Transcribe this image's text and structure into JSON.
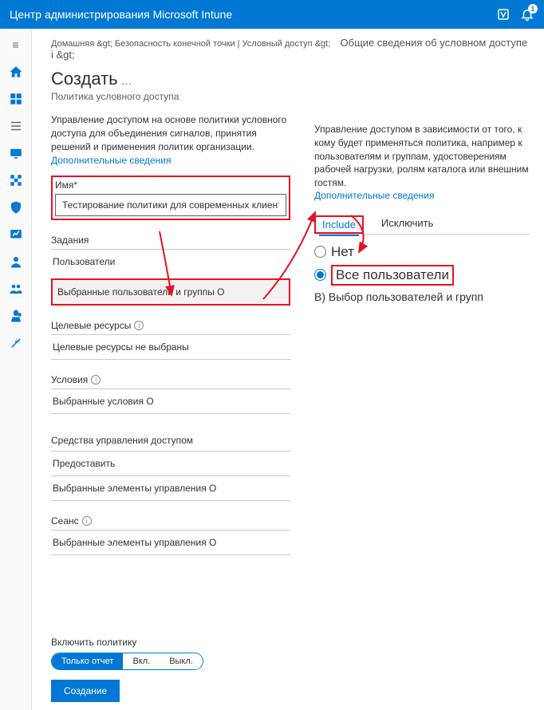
{
  "header": {
    "title": "Центр администрирования Microsoft Intune",
    "badge": "1"
  },
  "breadcrumb": {
    "home": "Домашняя &gt;",
    "path1": "Безопасность конечной точки | Условный доступ &gt;",
    "path2": "Общие сведения об условном доступе i &gt;"
  },
  "page": {
    "title": "Создать",
    "ellipsis": "…",
    "sub": "Политика условного доступа"
  },
  "left": {
    "desc": "Управление доступом на основе политики условного доступа для объединения сигналов, принятия решений и применения политик организации.",
    "more": "Дополнительные сведения",
    "name_label": "Имя",
    "name_value": "Тестирование политики для современных клиентов augh",
    "assignments": "Задания",
    "users": "Пользователи",
    "users_value": "Выбранные пользователи и группы O",
    "targets": "Целевые ресурсы",
    "targets_value": "Целевые ресурсы не выбраны",
    "conditions": "Условия",
    "conditions_value": "Выбранные условия O",
    "access_controls": "Средства управления доступом",
    "grant": "Предоставить",
    "grant_value": "Выбранные элементы управления O",
    "session": "Сеанс",
    "session_value": "Выбранные элементы управления O"
  },
  "right": {
    "desc": "Управление доступом в зависимости от того, к кому будет применяться политика, например к пользователям и группам, удостоверениям рабочей нагрузки, ролям каталога или внешним гостям.",
    "more": "Дополнительные сведения",
    "tab_include": "Include",
    "tab_exclude": "Исключить",
    "opt_none": "Нет",
    "opt_all": "Все пользователи",
    "opt_select": "B) Выбор пользователей и групп"
  },
  "footer": {
    "enable_label": "Включить политику",
    "report_only": "Только отчет",
    "on": "Вкл.",
    "off": "Выкл.",
    "create": "Создание"
  }
}
